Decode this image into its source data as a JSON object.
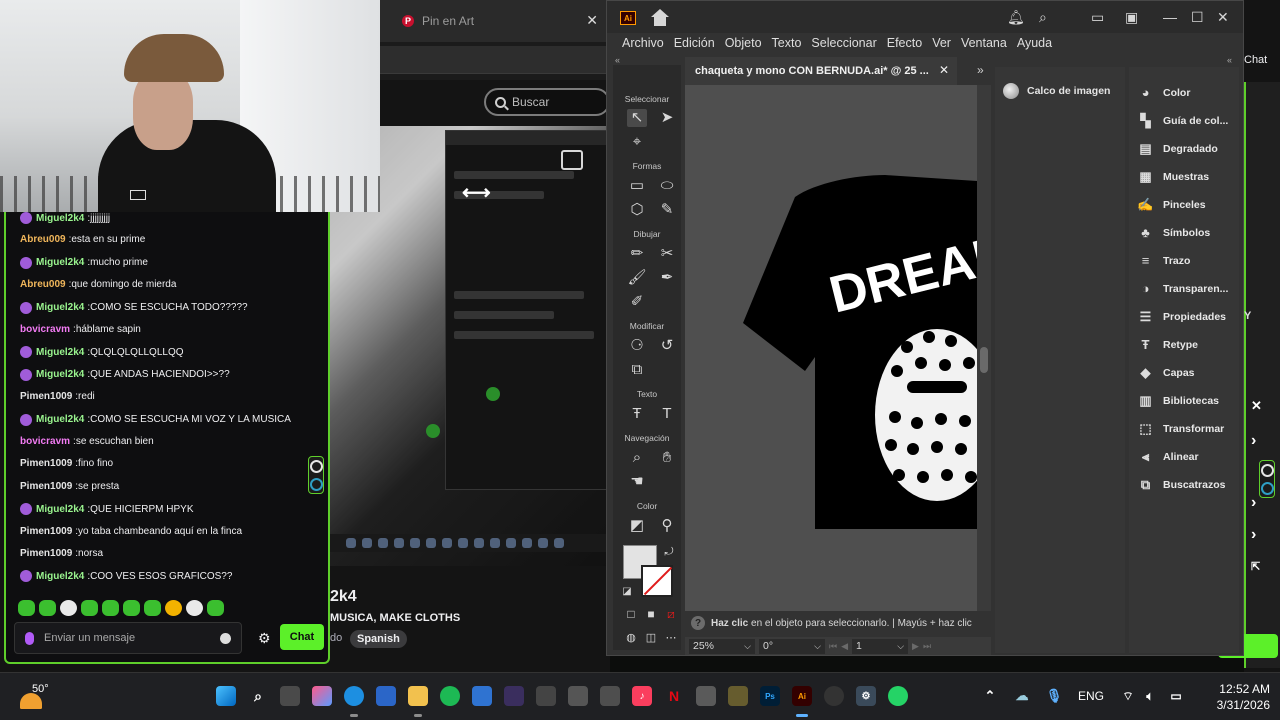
{
  "browser_tab": {
    "title": "Pin en Art",
    "close": "✕"
  },
  "search": {
    "placeholder": "Buscar"
  },
  "stream": {
    "title": "2k4",
    "subtitle": "MUSICA, MAKE CLOTHS",
    "lang_prefix": "do",
    "language": "Spanish"
  },
  "chat": {
    "messages": [
      {
        "user": "Miguel2k4",
        "text": "jjjjjjjjj",
        "color": "green",
        "badge": true
      },
      {
        "user": "Abreu009",
        "text": "esta en su prime",
        "color": "orange",
        "badge": false
      },
      {
        "user": "Miguel2k4",
        "text": "mucho prime",
        "color": "green",
        "badge": true
      },
      {
        "user": "Abreu009",
        "text": "que domingo de mierda",
        "color": "orange",
        "badge": false
      },
      {
        "user": "Miguel2k4",
        "text": "COMO SE ESCUCHA TODO?????",
        "color": "green",
        "badge": true
      },
      {
        "user": "bovicravm",
        "text": "háblame sapin",
        "color": "pink",
        "badge": false
      },
      {
        "user": "Miguel2k4",
        "text": "QLQLQLQLLQLLQQ",
        "color": "green",
        "badge": true
      },
      {
        "user": "Miguel2k4",
        "text": "QUE ANDAS HACIENDOI>>??",
        "color": "green",
        "badge": true
      },
      {
        "user": "Pimen1009",
        "text": "redi",
        "color": "white",
        "badge": false
      },
      {
        "user": "Miguel2k4",
        "text": "COMO SE ESCUCHA MI VOZ Y LA MUSICA",
        "color": "green",
        "badge": true
      },
      {
        "user": "bovicravm",
        "text": "se escuchan bien",
        "color": "pink",
        "badge": false
      },
      {
        "user": "Pimen1009",
        "text": "fino fino",
        "color": "white",
        "badge": false
      },
      {
        "user": "Pimen1009",
        "text": "se presta",
        "color": "white",
        "badge": false
      },
      {
        "user": "Miguel2k4",
        "text": "QUE HICIERPM HPYK",
        "color": "green",
        "badge": true
      },
      {
        "user": "Pimen1009",
        "text": "yo taba chambeando aquí en la finca",
        "color": "white",
        "badge": false
      },
      {
        "user": "Pimen1009",
        "text": "norsa",
        "color": "white",
        "badge": false
      },
      {
        "user": "Miguel2k4",
        "text": "COO VES ESOS GRAFICOS??",
        "color": "green",
        "badge": true
      }
    ],
    "input_placeholder": "Enviar un mensaje",
    "send_label": "Chat"
  },
  "right_strip": {
    "chat_label": "Chat",
    "close": "✕",
    "letter": "Y"
  },
  "illustrator": {
    "logo": "Ai",
    "menu": [
      "Archivo",
      "Edición",
      "Objeto",
      "Texto",
      "Seleccionar",
      "Efecto",
      "Ver",
      "Ventana",
      "Ayuda"
    ],
    "doc_tab": "chaqueta y mono CON BERNUDA.ai* @ 25 ...",
    "doc_close": "✕",
    "tool_categories": [
      "Seleccionar",
      "Formas",
      "Dibujar",
      "Modificar",
      "Texto",
      "Navegación",
      "Color"
    ],
    "calco_label": "Calco de imagen",
    "panels": [
      "Color",
      "Guía de col...",
      "Degradado",
      "Muestras",
      "Pinceles",
      "Símbolos",
      "Trazo",
      "Transparen...",
      "Propiedades",
      "Retype",
      "Capas",
      "Bibliotecas",
      "Transformar",
      "Alinear",
      "Buscatrazos"
    ],
    "status_hint_bold": "Haz clic",
    "status_hint": " en el objeto para seleccionarlo.  |  Mayús + haz clic",
    "zoom": "25%",
    "rotation": "0°",
    "artboard": "1",
    "artwork_text": "DREAM"
  },
  "taskbar": {
    "temperature": "50°",
    "language": "ENG",
    "time": "12:52 AM",
    "date": "3/31/2026"
  }
}
